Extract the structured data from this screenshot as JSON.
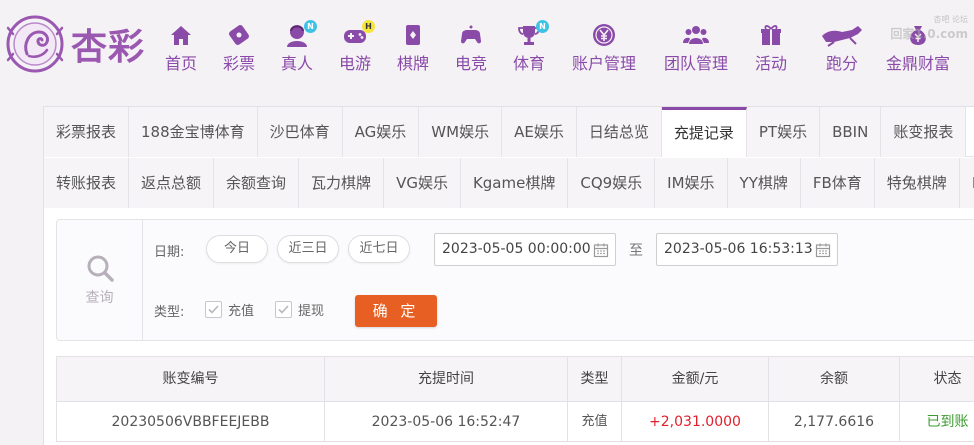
{
  "brand": {
    "logo_text": "杏彩"
  },
  "nav": [
    {
      "label": "首页",
      "icon": "home-icon"
    },
    {
      "label": "彩票",
      "icon": "lottery-ticket-icon"
    },
    {
      "label": "真人",
      "icon": "live-dealer-icon",
      "badge": "N"
    },
    {
      "label": "电游",
      "icon": "gamepad-icon",
      "badge": "H"
    },
    {
      "label": "棋牌",
      "icon": "playing-cards-icon"
    },
    {
      "label": "电竞",
      "icon": "esports-controller-icon"
    },
    {
      "label": "体育",
      "icon": "trophy-icon",
      "badge": "N"
    },
    {
      "label": "账户管理",
      "icon": "yen-coin-icon"
    },
    {
      "label": "团队管理",
      "icon": "team-icon"
    },
    {
      "label": "活动",
      "icon": "gift-icon"
    },
    {
      "label": "跑分",
      "icon": "running-dog-icon"
    },
    {
      "label": "金鼎财富",
      "icon": "money-bag-icon"
    }
  ],
  "watermark": {
    "line1": "杏吧  论坛",
    "line2": "回家1.0.com"
  },
  "tabs_row1": [
    {
      "label": "彩票报表"
    },
    {
      "label": "188金宝博体育"
    },
    {
      "label": "沙巴体育"
    },
    {
      "label": "AG娱乐"
    },
    {
      "label": "WM娱乐"
    },
    {
      "label": "AE娱乐"
    },
    {
      "label": "日结总览"
    },
    {
      "label": "充提记录",
      "active": true
    },
    {
      "label": "PT娱乐"
    },
    {
      "label": "BBIN"
    },
    {
      "label": "账变报表"
    }
  ],
  "tabs_row2": [
    {
      "label": "转账报表"
    },
    {
      "label": "返点总额"
    },
    {
      "label": "余额查询"
    },
    {
      "label": "瓦力棋牌"
    },
    {
      "label": "VG娱乐"
    },
    {
      "label": "Kgame棋牌"
    },
    {
      "label": "CQ9娱乐"
    },
    {
      "label": "IM娱乐"
    },
    {
      "label": "YY棋牌"
    },
    {
      "label": "FB体育"
    },
    {
      "label": "特兔棋牌"
    },
    {
      "label": "I"
    }
  ],
  "filter": {
    "query_label": "查询",
    "date_label": "日期:",
    "quick_ranges": [
      "今日",
      "近三日",
      "近七日"
    ],
    "start_date": "2023-05-05 00:00:00",
    "to_label": "至",
    "end_date": "2023-05-06 16:53:13",
    "type_label": "类型:",
    "types": [
      {
        "label": "充值",
        "checked": true
      },
      {
        "label": "提现",
        "checked": true
      }
    ],
    "confirm_label": "确 定"
  },
  "table": {
    "headers": [
      "账变编号",
      "充提时间",
      "类型",
      "金额/元",
      "余额",
      "状态"
    ],
    "rows": [
      {
        "id": "20230506VBBFEEJEBB",
        "time": "2023-05-06 16:52:47",
        "type": "充值",
        "amount": "+2,031.0000",
        "balance": "2,177.6616",
        "status": "已到账"
      }
    ]
  },
  "colors": {
    "brand_purple": "#8a4aa8",
    "accent_orange": "#e85f24",
    "amount_red": "#e0202c",
    "status_green": "#3a9c2f"
  }
}
